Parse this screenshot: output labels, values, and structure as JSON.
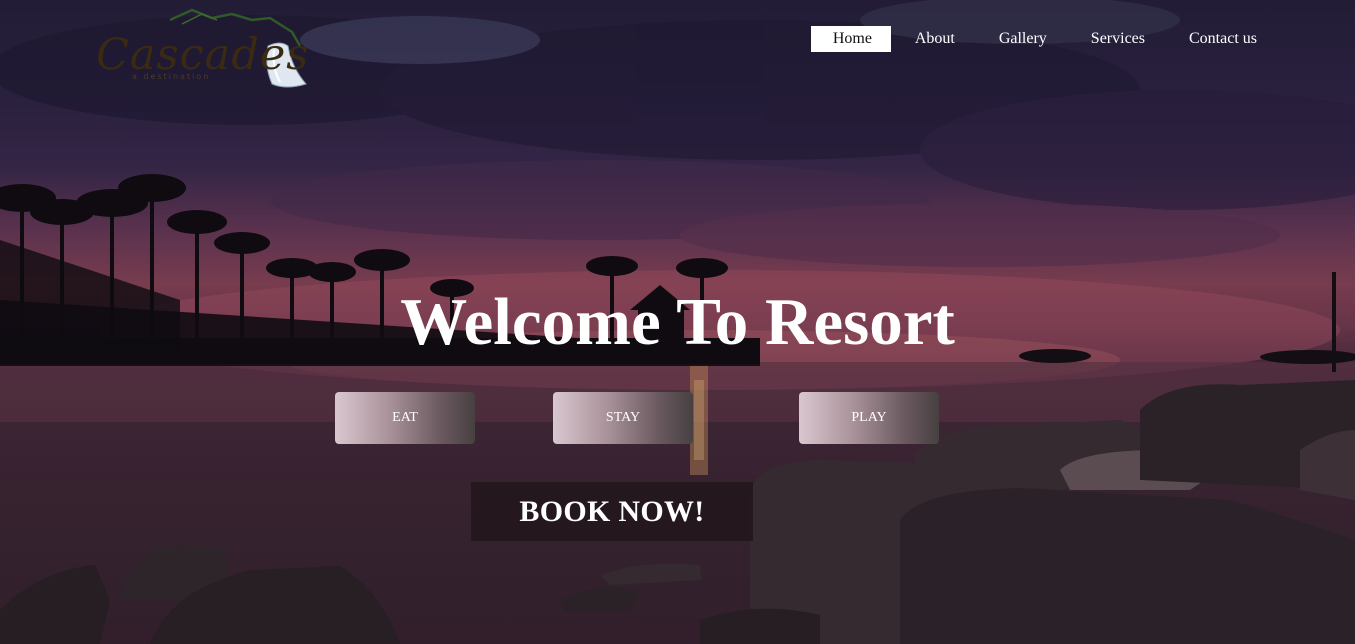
{
  "logo": {
    "name": "Cascades",
    "tagline": "a destination"
  },
  "nav": {
    "items": [
      {
        "label": "Home",
        "active": true
      },
      {
        "label": "About",
        "active": false
      },
      {
        "label": "Gallery",
        "active": false
      },
      {
        "label": "Services",
        "active": false
      },
      {
        "label": "Contact us",
        "active": false
      }
    ]
  },
  "hero": {
    "title": "Welcome To Resort",
    "buttons": [
      {
        "label": "EAT"
      },
      {
        "label": "STAY"
      },
      {
        "label": "PLAY"
      }
    ],
    "cta": "BOOK NOW!"
  },
  "colors": {
    "accent": "#ffffff",
    "sky": "#2c2444",
    "sunset": "#8c4658"
  }
}
